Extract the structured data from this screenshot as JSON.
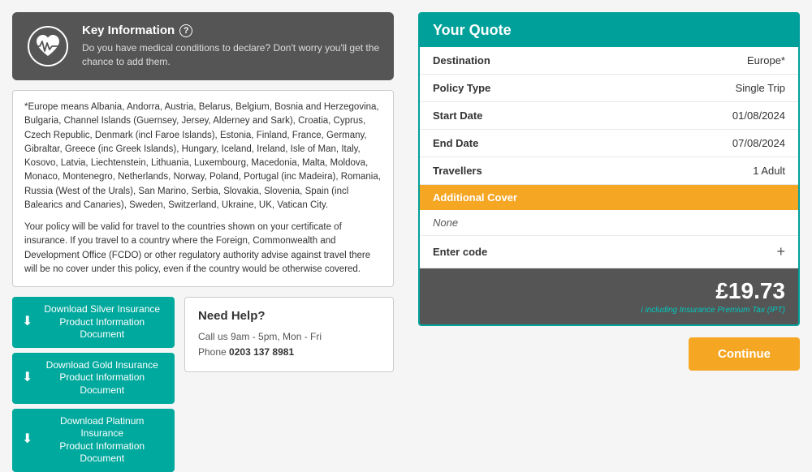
{
  "keyInfo": {
    "title": "Key Information",
    "infoIcon": "?",
    "description": "Do you have medical conditions to declare? Don't worry you'll get the chance to add them."
  },
  "europeNote": {
    "paragraph1": "*Europe means Albania, Andorra, Austria, Belarus, Belgium, Bosnia and Herzegovina, Bulgaria, Channel Islands (Guernsey, Jersey, Alderney and Sark), Croatia, Cyprus, Czech Republic, Denmark (incl Faroe Islands), Estonia, Finland, France, Germany, Gibraltar, Greece (inc Greek Islands), Hungary, Iceland, Ireland, Isle of Man, Italy, Kosovo, Latvia, Liechtenstein, Lithuania, Luxembourg, Macedonia, Malta, Moldova, Monaco, Montenegro, Netherlands, Norway, Poland, Portugal (inc Madeira), Romania, Russia (West of the Urals), San Marino, Serbia, Slovakia, Slovenia, Spain (incl Balearics and Canaries), Sweden, Switzerland, Ukraine, UK, Vatican City.",
    "paragraph2": "Your policy will be valid for travel to the countries shown on your certificate of insurance. If you travel to a country where the Foreign, Commonwealth and Development Office (FCDO) or other regulatory authority advise against travel there will be no cover under this policy, even if the country would be otherwise covered."
  },
  "downloadButtons": [
    {
      "label": "Download Silver Insurance\nProduct Information Document",
      "id": "silver"
    },
    {
      "label": "Download Gold Insurance\nProduct Information Document",
      "id": "gold"
    },
    {
      "label": "Download Platinum Insurance\nProduct Information Document",
      "id": "platinum"
    }
  ],
  "needHelp": {
    "title": "Need Help?",
    "line1": "Call us 9am - 5pm, Mon - Fri",
    "line2Label": "Phone",
    "phone": "0203 137 8981"
  },
  "quote": {
    "title": "Your Quote",
    "rows": [
      {
        "label": "Destination",
        "value": "Europe*"
      },
      {
        "label": "Policy Type",
        "value": "Single Trip"
      },
      {
        "label": "Start Date",
        "value": "01/08/2024"
      },
      {
        "label": "End Date",
        "value": "07/08/2024"
      },
      {
        "label": "Travellers",
        "value": "1 Adult"
      }
    ],
    "additionalCover": {
      "header": "Additional Cover",
      "value": "None"
    },
    "enterCode": "Enter code",
    "price": "£19.73",
    "priceSubtext": "including Insurance Premium Tax (IPT)",
    "continueLabel": "Continue"
  }
}
